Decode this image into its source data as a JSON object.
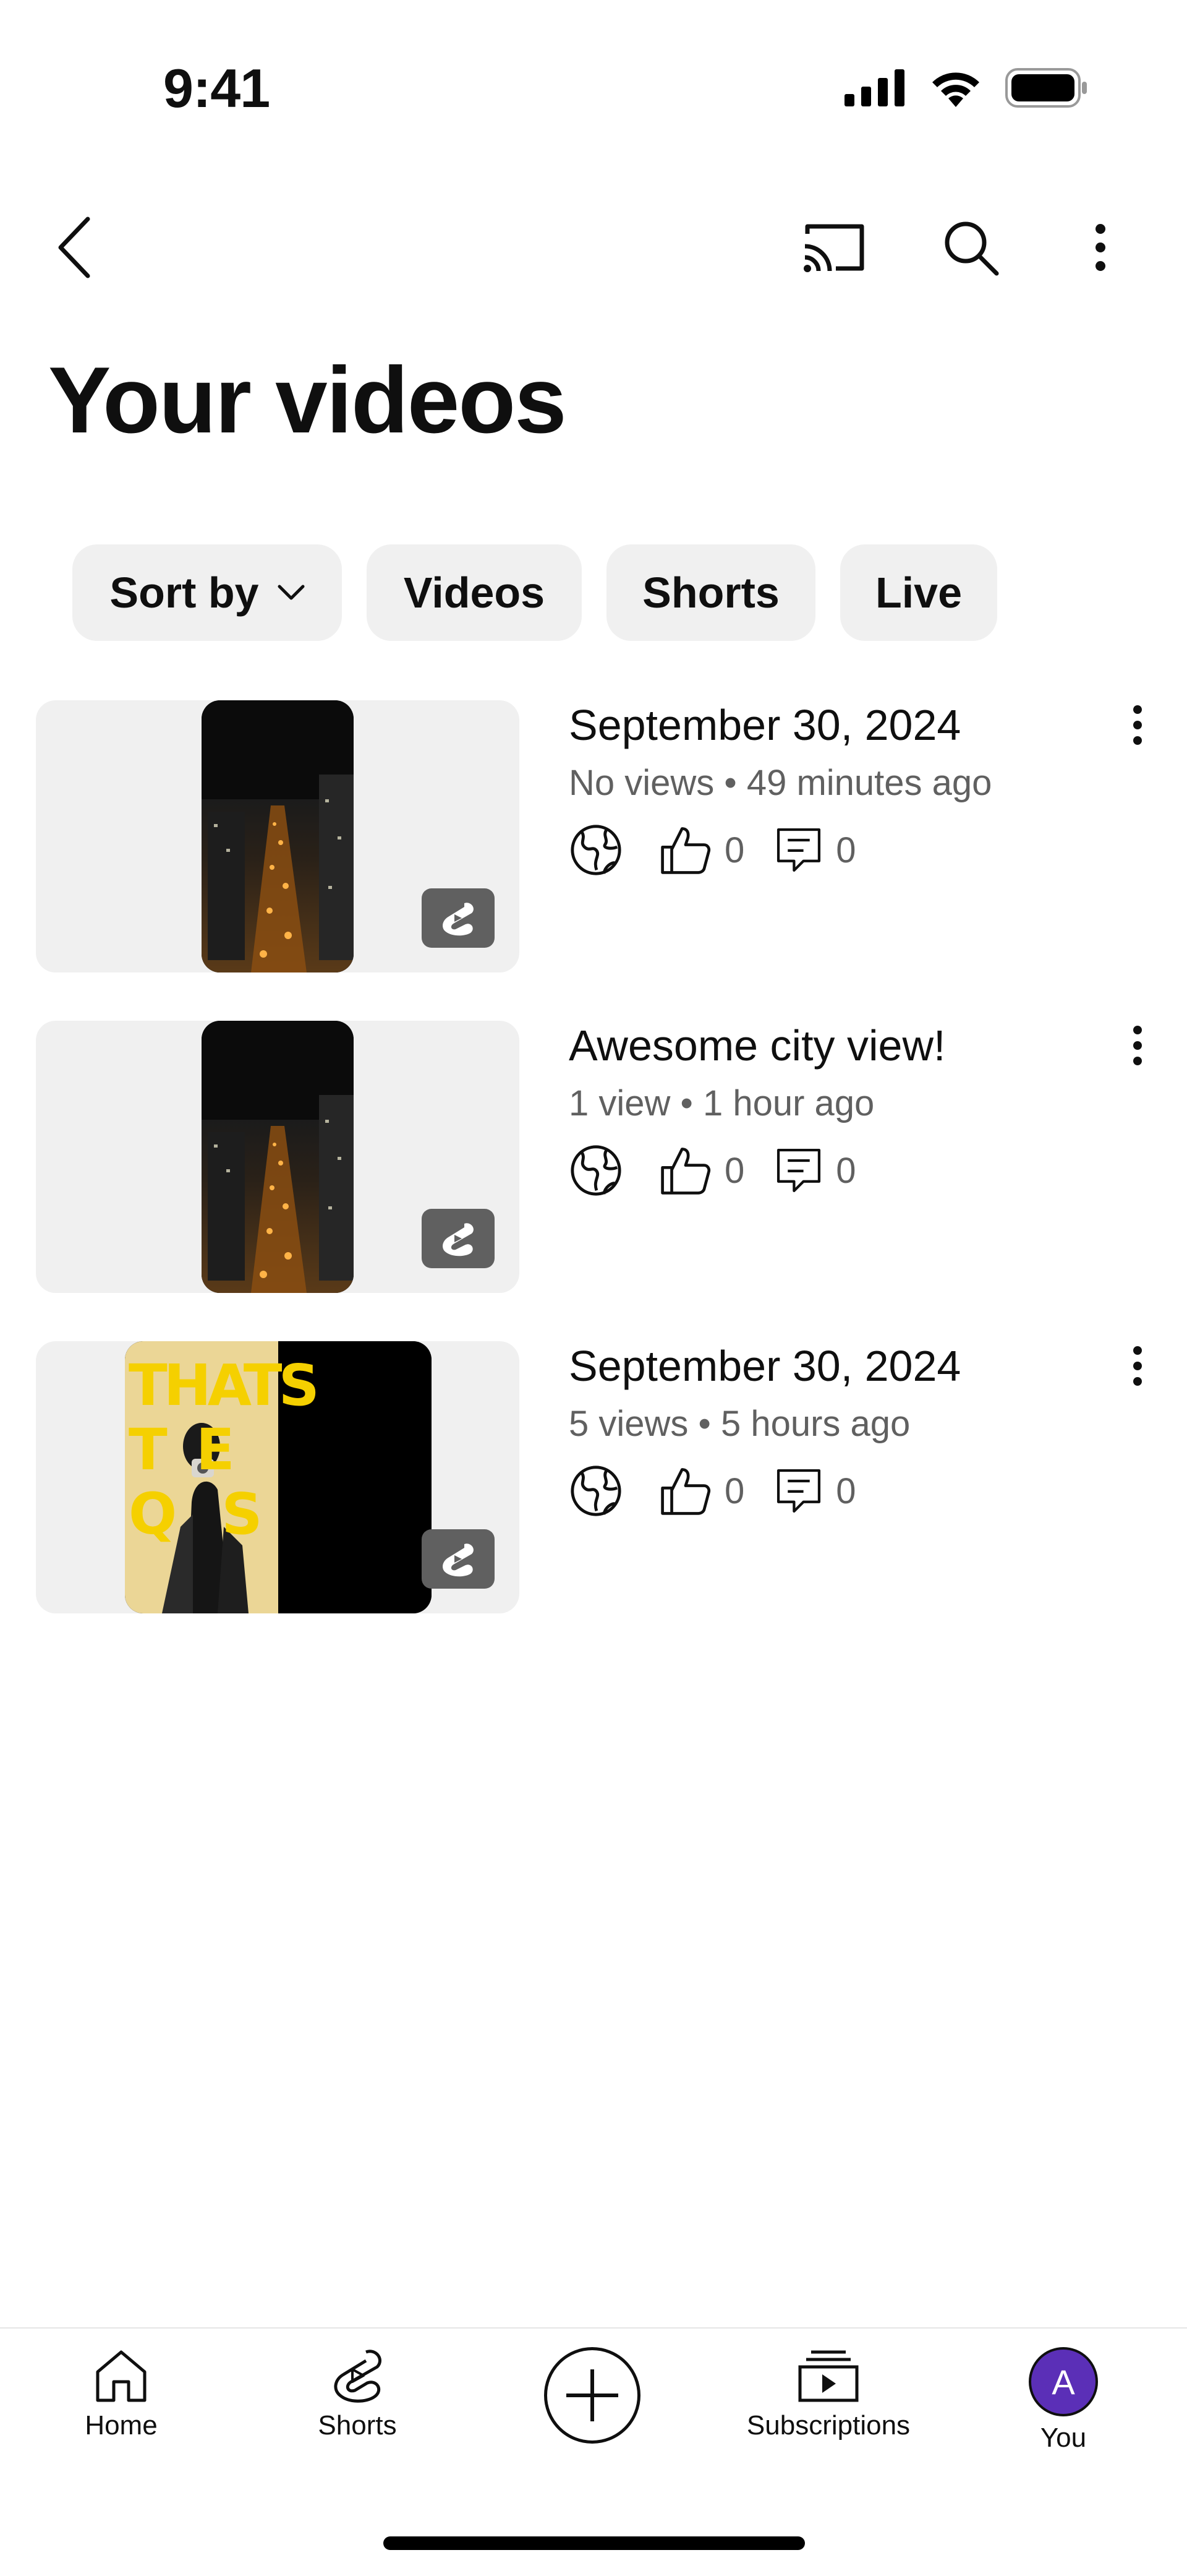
{
  "status_bar": {
    "time": "9:41"
  },
  "header": {
    "title": "Your videos",
    "icons": [
      "back-arrow-icon",
      "cast-icon",
      "search-icon",
      "more-vertical-icon"
    ]
  },
  "chips": {
    "sort_label": "Sort by",
    "videos_label": "Videos",
    "shorts_label": "Shorts",
    "live_label": "Live"
  },
  "videos": [
    {
      "title": "September 30, 2024",
      "views": "No views",
      "age": "49 minutes ago",
      "likes": "0",
      "comments": "0",
      "type": "Short"
    },
    {
      "title": "Awesome city view!",
      "views": "1 view",
      "age": "1 hour ago",
      "likes": "0",
      "comments": "0",
      "type": "Short"
    },
    {
      "title": "September 30, 2024",
      "views": "5 views",
      "age": "5 hours ago",
      "likes": "0",
      "comments": "0",
      "type": "Short"
    }
  ],
  "thumbnail_text": {
    "line1": "THATS",
    "line2": "T  E",
    "line3": "Q   S"
  },
  "bottom_nav": {
    "home": "Home",
    "shorts": "Shorts",
    "subscriptions": "Subscriptions",
    "you": "You",
    "avatar_letter": "A"
  },
  "colors": {
    "avatar": "#5b2fb7",
    "chip_bg": "#f0f0f0",
    "meta_text": "#606060"
  }
}
